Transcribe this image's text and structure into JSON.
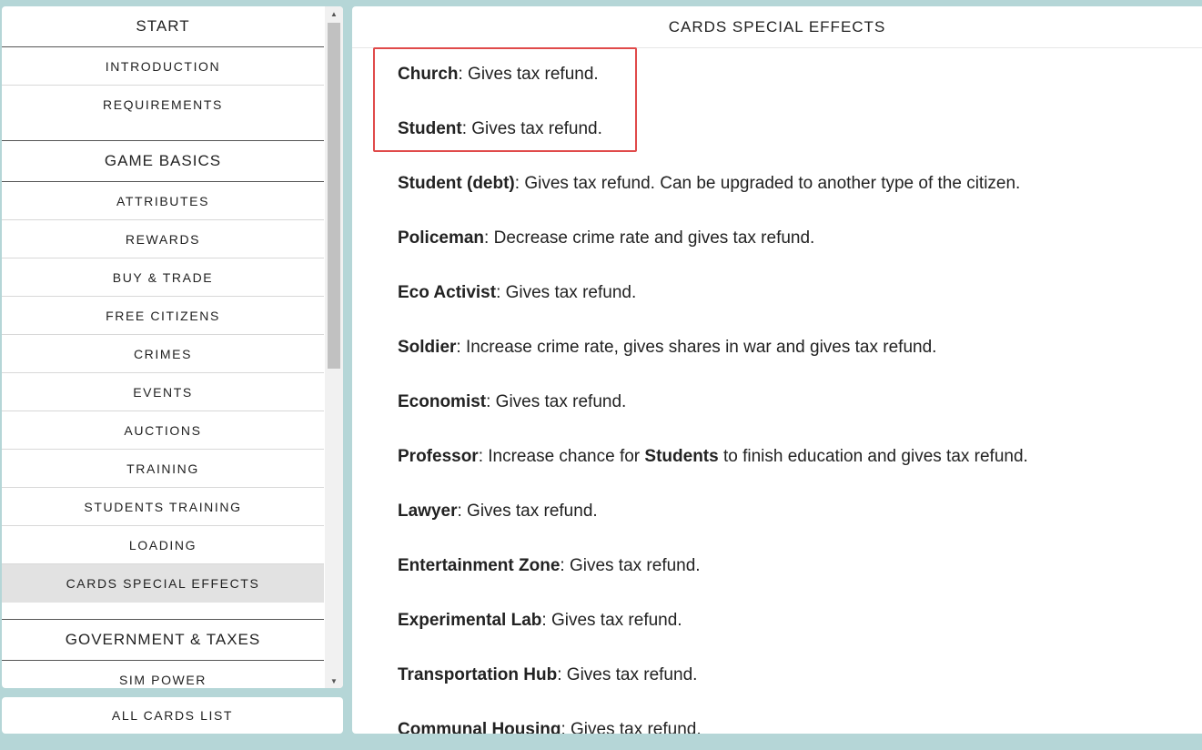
{
  "sidebar": {
    "start_header": "START",
    "start_items": [
      "INTRODUCTION",
      "REQUIREMENTS"
    ],
    "game_basics_header": "GAME BASICS",
    "game_basics_items": [
      "ATTRIBUTES",
      "REWARDS",
      "BUY & TRADE",
      "FREE CITIZENS",
      "CRIMES",
      "EVENTS",
      "AUCTIONS",
      "TRAINING",
      "STUDENTS TRAINING",
      "LOADING",
      "CARDS SPECIAL EFFECTS"
    ],
    "gov_header": "GOVERNMENT & TAXES",
    "gov_items": [
      "SIM POWER"
    ]
  },
  "all_cards_label": "ALL CARDS LIST",
  "main": {
    "title": "CARDS SPECIAL EFFECTS",
    "effects": [
      {
        "name": "Church",
        "text": ": Gives tax refund."
      },
      {
        "name": "Student",
        "text": ": Gives tax refund."
      },
      {
        "name": "Student (debt)",
        "text": ": Gives tax refund. Can be upgraded to another type of the citizen."
      },
      {
        "name": "Policeman",
        "text": ": Decrease crime rate and gives tax refund."
      },
      {
        "name": "Eco Activist",
        "text": ": Gives tax refund."
      },
      {
        "name": "Soldier",
        "text": ": Increase crime rate, gives shares in war and gives tax refund."
      },
      {
        "name": "Economist",
        "text": ": Gives tax refund."
      },
      {
        "name": "Professor",
        "text": ": Increase chance for ",
        "bold2": "Students",
        "text2": " to finish education and gives tax refund."
      },
      {
        "name": "Lawyer",
        "text": ": Gives tax refund."
      },
      {
        "name": "Entertainment Zone",
        "text": ": Gives tax refund."
      },
      {
        "name": "Experimental Lab",
        "text": ": Gives tax refund."
      },
      {
        "name": "Transportation Hub",
        "text": ": Gives tax refund."
      },
      {
        "name": "Communal Housing",
        "text": ": Gives tax refund."
      }
    ]
  },
  "colors": {
    "background": "#b5d6d7",
    "highlight_border": "#e04a4a",
    "active_item": "#e2e2e2"
  }
}
